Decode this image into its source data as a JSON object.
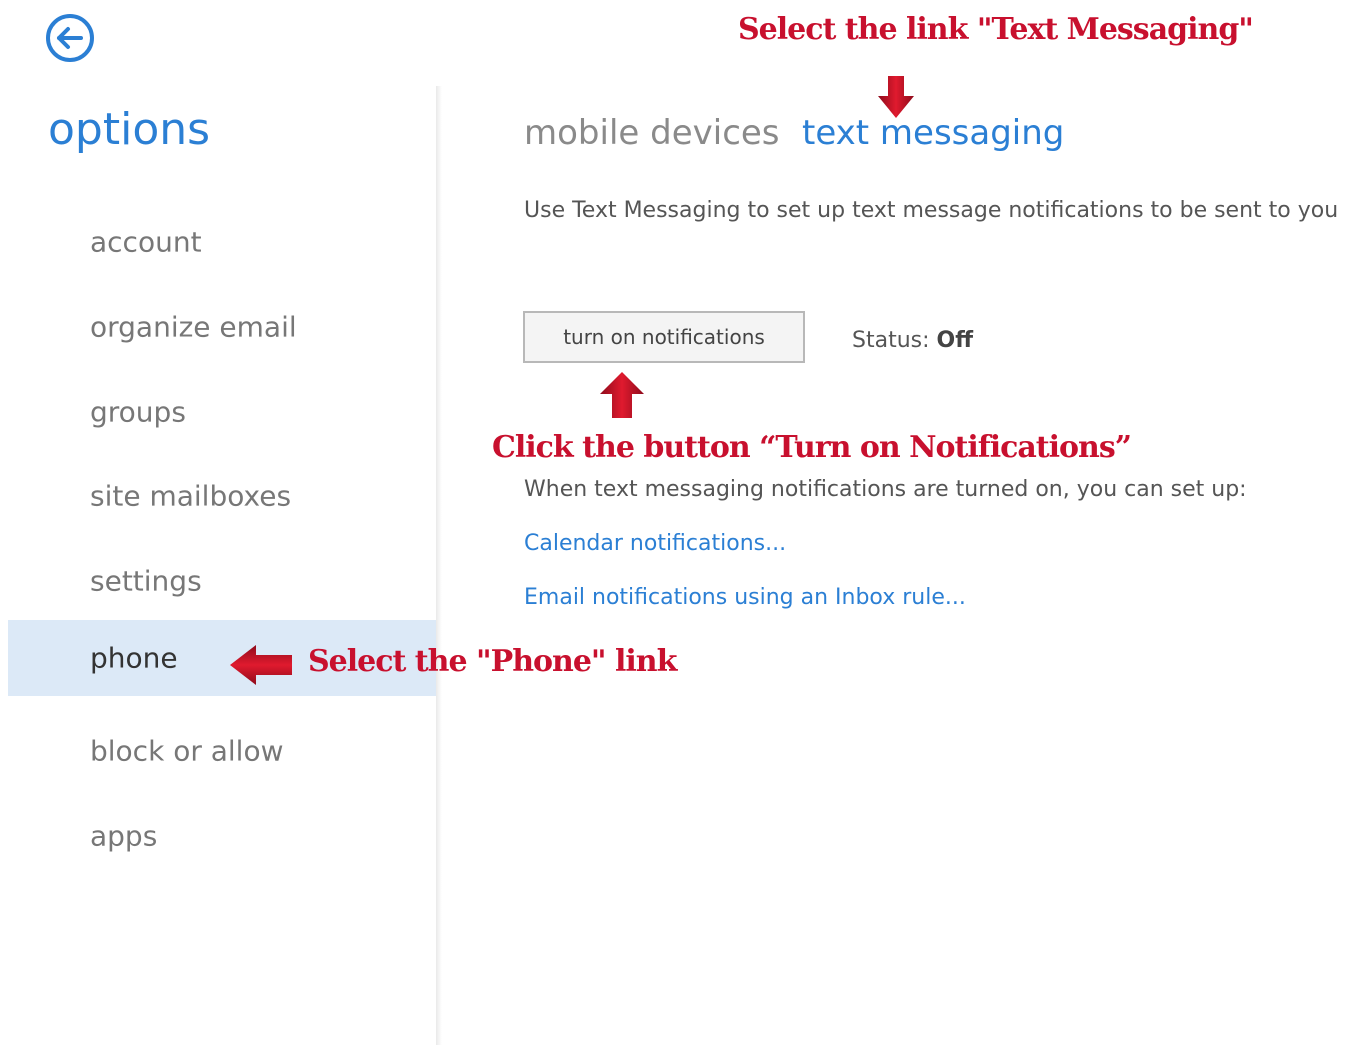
{
  "nav": {
    "title": "options",
    "items": [
      {
        "label": "account"
      },
      {
        "label": "organize email"
      },
      {
        "label": "groups"
      },
      {
        "label": "site mailboxes"
      },
      {
        "label": "settings"
      },
      {
        "label": "phone"
      },
      {
        "label": "block or allow"
      },
      {
        "label": "apps"
      }
    ],
    "selected": "phone"
  },
  "tabs": {
    "mobile_devices": "mobile devices",
    "text_messaging": "text messaging",
    "active": "text messaging"
  },
  "content": {
    "description": "Use Text Messaging to set up text message notifications to be sent to you",
    "button_label": "turn on notifications",
    "status_label": "Status: ",
    "status_value": "Off",
    "when_text": "When text messaging notifications are turned on, you can set up:",
    "calendar_link": "Calendar notifications...",
    "email_link": "Email notifications using an Inbox rule..."
  },
  "annotations": {
    "top": "Select the link \"Text Messaging\"",
    "button": "Click the button “Turn on Notifications”",
    "phone": "Select the \"Phone\" link"
  },
  "icons": {
    "back": "back-arrow-circle-icon",
    "annotation_arrows": "red-arrow-icon"
  },
  "colors": {
    "accent": "#2b7fd4",
    "selected_bg": "#dce9f7",
    "annotation": "#c8102e"
  }
}
